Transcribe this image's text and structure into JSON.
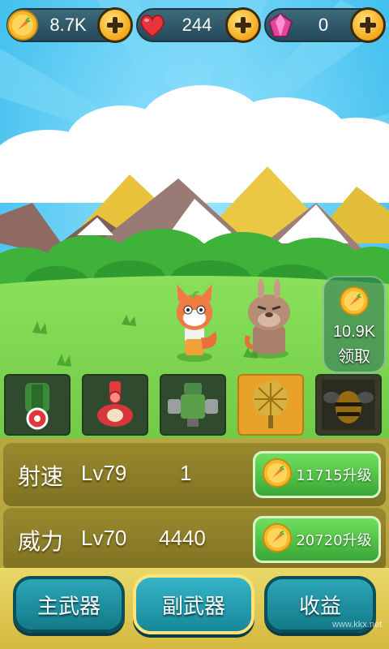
{
  "resources": {
    "coins": {
      "value": "8.7K",
      "icon": "carrot-coin-icon"
    },
    "hearts": {
      "value": "244",
      "icon": "heart-icon"
    },
    "gems": {
      "value": "0",
      "icon": "gem-icon"
    }
  },
  "claim": {
    "amount": "10.9K",
    "label": "领取"
  },
  "weapons": [
    {
      "icon": "green-cannon-icon"
    },
    {
      "icon": "red-cannon-icon"
    },
    {
      "icon": "gatling-icon"
    },
    {
      "icon": "golden-tree-icon",
      "selected": true
    },
    {
      "icon": "locked-bee-icon"
    }
  ],
  "upgrades": [
    {
      "name": "射速",
      "level": "Lv79",
      "value": "1",
      "cost": "11715升级"
    },
    {
      "name": "威力",
      "level": "Lv70",
      "value": "4440",
      "cost": "20720升级"
    }
  ],
  "tabs": {
    "primary": "主武器",
    "secondary": "副武器",
    "income": "收益"
  },
  "watermark": "www.kkx.net",
  "colors": {
    "sky": "#4fc7f0",
    "grass": "#6fd34a",
    "panel": "#8f8028",
    "button": "#4cc245",
    "tab": "#1f95a6"
  }
}
